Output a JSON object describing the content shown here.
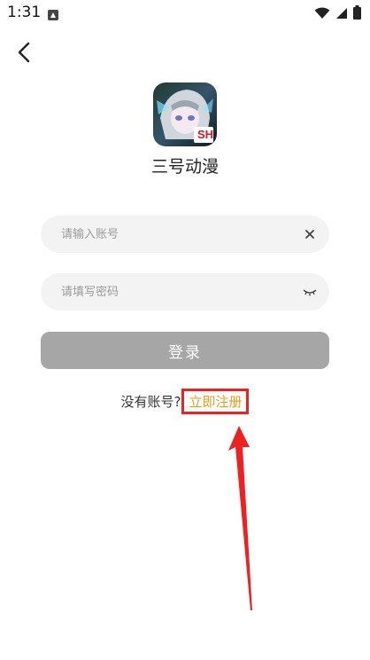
{
  "status_bar": {
    "time": "1:31",
    "app_icon": "app-notification-icon",
    "wifi_icon": "wifi-icon",
    "signal_icon": "signal-icon",
    "battery_icon": "battery-icon"
  },
  "nav": {
    "back_icon": "back-arrow-icon"
  },
  "app": {
    "name": "三号动漫",
    "logo_badge": "SH"
  },
  "form": {
    "account": {
      "placeholder": "请输入账号",
      "value": ""
    },
    "password": {
      "placeholder": "请填写密码",
      "value": ""
    },
    "login_label": "登录"
  },
  "register": {
    "prompt": "没有账号?",
    "link": "立即注册"
  },
  "colors": {
    "accent": "#f09a1a",
    "highlight": "#ee2020",
    "button_disabled": "#a6a6a6",
    "field_bg": "#f3f3f3"
  }
}
